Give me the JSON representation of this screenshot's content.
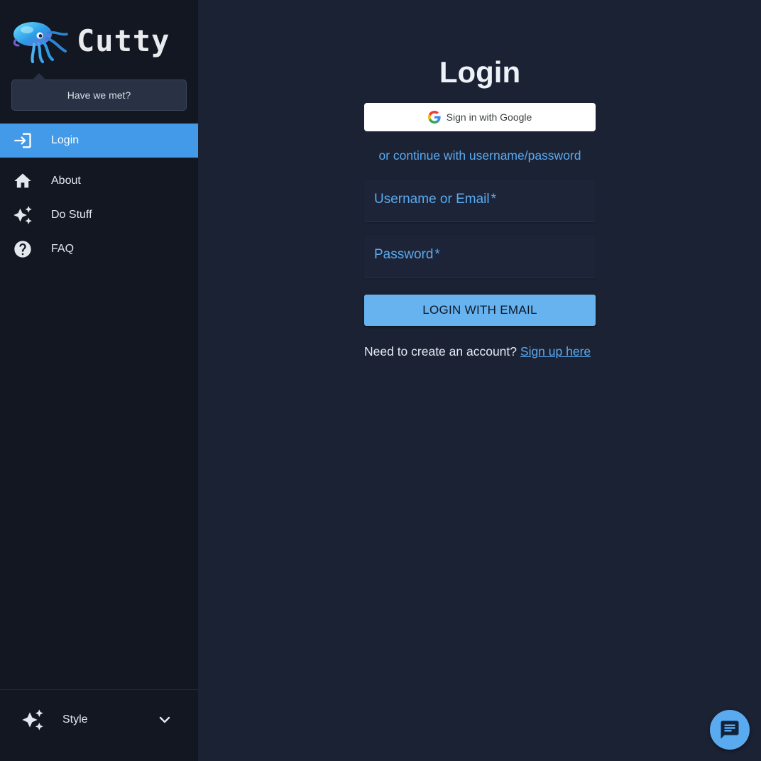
{
  "brand": {
    "name": "Cutty",
    "logo_icon": "squid-logo-icon"
  },
  "greeting_bubble": {
    "text": "Have we met?"
  },
  "sidebar": {
    "items": [
      {
        "label": "Login",
        "icon": "login-icon",
        "active": true
      },
      {
        "label": "About",
        "icon": "home-icon",
        "active": false
      },
      {
        "label": "Do Stuff",
        "icon": "sparkles-icon",
        "active": false
      },
      {
        "label": "FAQ",
        "icon": "help-circle-icon",
        "active": false
      }
    ],
    "style_toggle": {
      "label": "Style",
      "icon": "sparkles-icon",
      "chevron": "chevron-down-icon"
    }
  },
  "login": {
    "title": "Login",
    "google_button": "Sign in with Google",
    "continue_text": "or continue with username/password",
    "username_label": "Username or Email",
    "password_label": "Password",
    "required_marker": "*",
    "submit_button": "LOGIN WITH EMAIL",
    "signup_prompt": "Need to create an account?",
    "signup_link": "Sign up here"
  },
  "chat_button": {
    "icon": "chat-icon"
  },
  "colors": {
    "sidebar_bg": "#121722",
    "main_bg": "#1b2234",
    "accent": "#429ae8",
    "link": "#5aaaf0",
    "login_button": "#66b3ef"
  }
}
